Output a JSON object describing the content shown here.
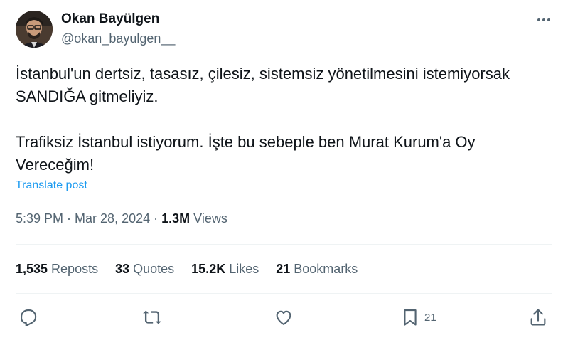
{
  "author": {
    "display_name": "Okan Bayülgen",
    "handle": "@okan_bayulgen__",
    "avatar_icon": "profile-photo"
  },
  "tweet": {
    "paragraphs": [
      [
        "İstanbul'un dertsiz, tasasız, çilesiz, sistemsiz yönetilmesini istemiyorsak",
        "SANDIĞA gitmeliyiz."
      ],
      [
        "Trafiksiz İstanbul istiyorum. İşte bu sebeple ben Murat Kurum'a Oy",
        "Vereceğim!"
      ]
    ],
    "translate_label": "Translate post"
  },
  "meta": {
    "time": "5:39 PM",
    "separator": " · ",
    "date": "Mar 28, 2024",
    "views_count": "1.3M",
    "views_label": " Views"
  },
  "stats": [
    {
      "count": "1,535",
      "label": " Reposts"
    },
    {
      "count": "33",
      "label": " Quotes"
    },
    {
      "count": "15.2K",
      "label": " Likes"
    },
    {
      "count": "21",
      "label": " Bookmarks"
    }
  ],
  "actions": {
    "reply_icon": "reply-icon",
    "repost_icon": "repost-icon",
    "like_icon": "heart-icon",
    "bookmark_icon": "bookmark-icon",
    "bookmark_count": "21",
    "share_icon": "share-icon"
  },
  "colors": {
    "text": "#0f1419",
    "secondary": "#536471",
    "link": "#1d9bf0",
    "divider": "#eff3f4"
  }
}
